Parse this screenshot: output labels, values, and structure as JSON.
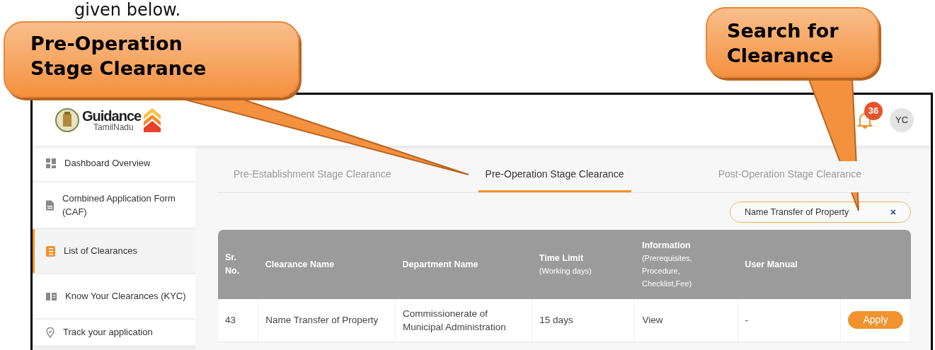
{
  "document_text": "given below.",
  "callouts": [
    {
      "text": "Pre-Operation Stage Clearance"
    },
    {
      "text": "Search for Clearance"
    }
  ],
  "header": {
    "logo_title": "Guidance",
    "logo_subtitle": "TamilNadu",
    "notification_count": "36",
    "avatar_initials": "YC"
  },
  "sidebar": {
    "items": [
      {
        "label": "Dashboard Overview",
        "selected": false
      },
      {
        "label": "Combined Application Form (CAF)",
        "selected": false
      },
      {
        "label": "List of Clearances",
        "selected": true
      },
      {
        "label": "Know Your Clearances (KYC)",
        "selected": false
      },
      {
        "label": "Track your application",
        "selected": false
      }
    ]
  },
  "tabs": [
    {
      "label": "Pre-Establishment Stage Clearance",
      "selected": false
    },
    {
      "label": "Pre-Operation Stage Clearance",
      "selected": true
    },
    {
      "label": "Post-Operation Stage Clearance",
      "selected": false
    }
  ],
  "search": {
    "value": "Name Transfer of Property",
    "clear": "×"
  },
  "table": {
    "columns": [
      {
        "title": "Sr. No."
      },
      {
        "title": "Clearance Name"
      },
      {
        "title": "Department Name"
      },
      {
        "title": "Time Limit",
        "subtitle": "(Working days)"
      },
      {
        "title": "Information",
        "subtitle": "(Prerequisites, Procedure, Checklist,Fee)"
      },
      {
        "title": "User Manual"
      }
    ],
    "rows": [
      {
        "cells": [
          "43",
          "Name Transfer of Property",
          "Commissionerate of Municipal Administration",
          "15 days",
          "View",
          "-"
        ],
        "action": "Apply"
      }
    ]
  }
}
